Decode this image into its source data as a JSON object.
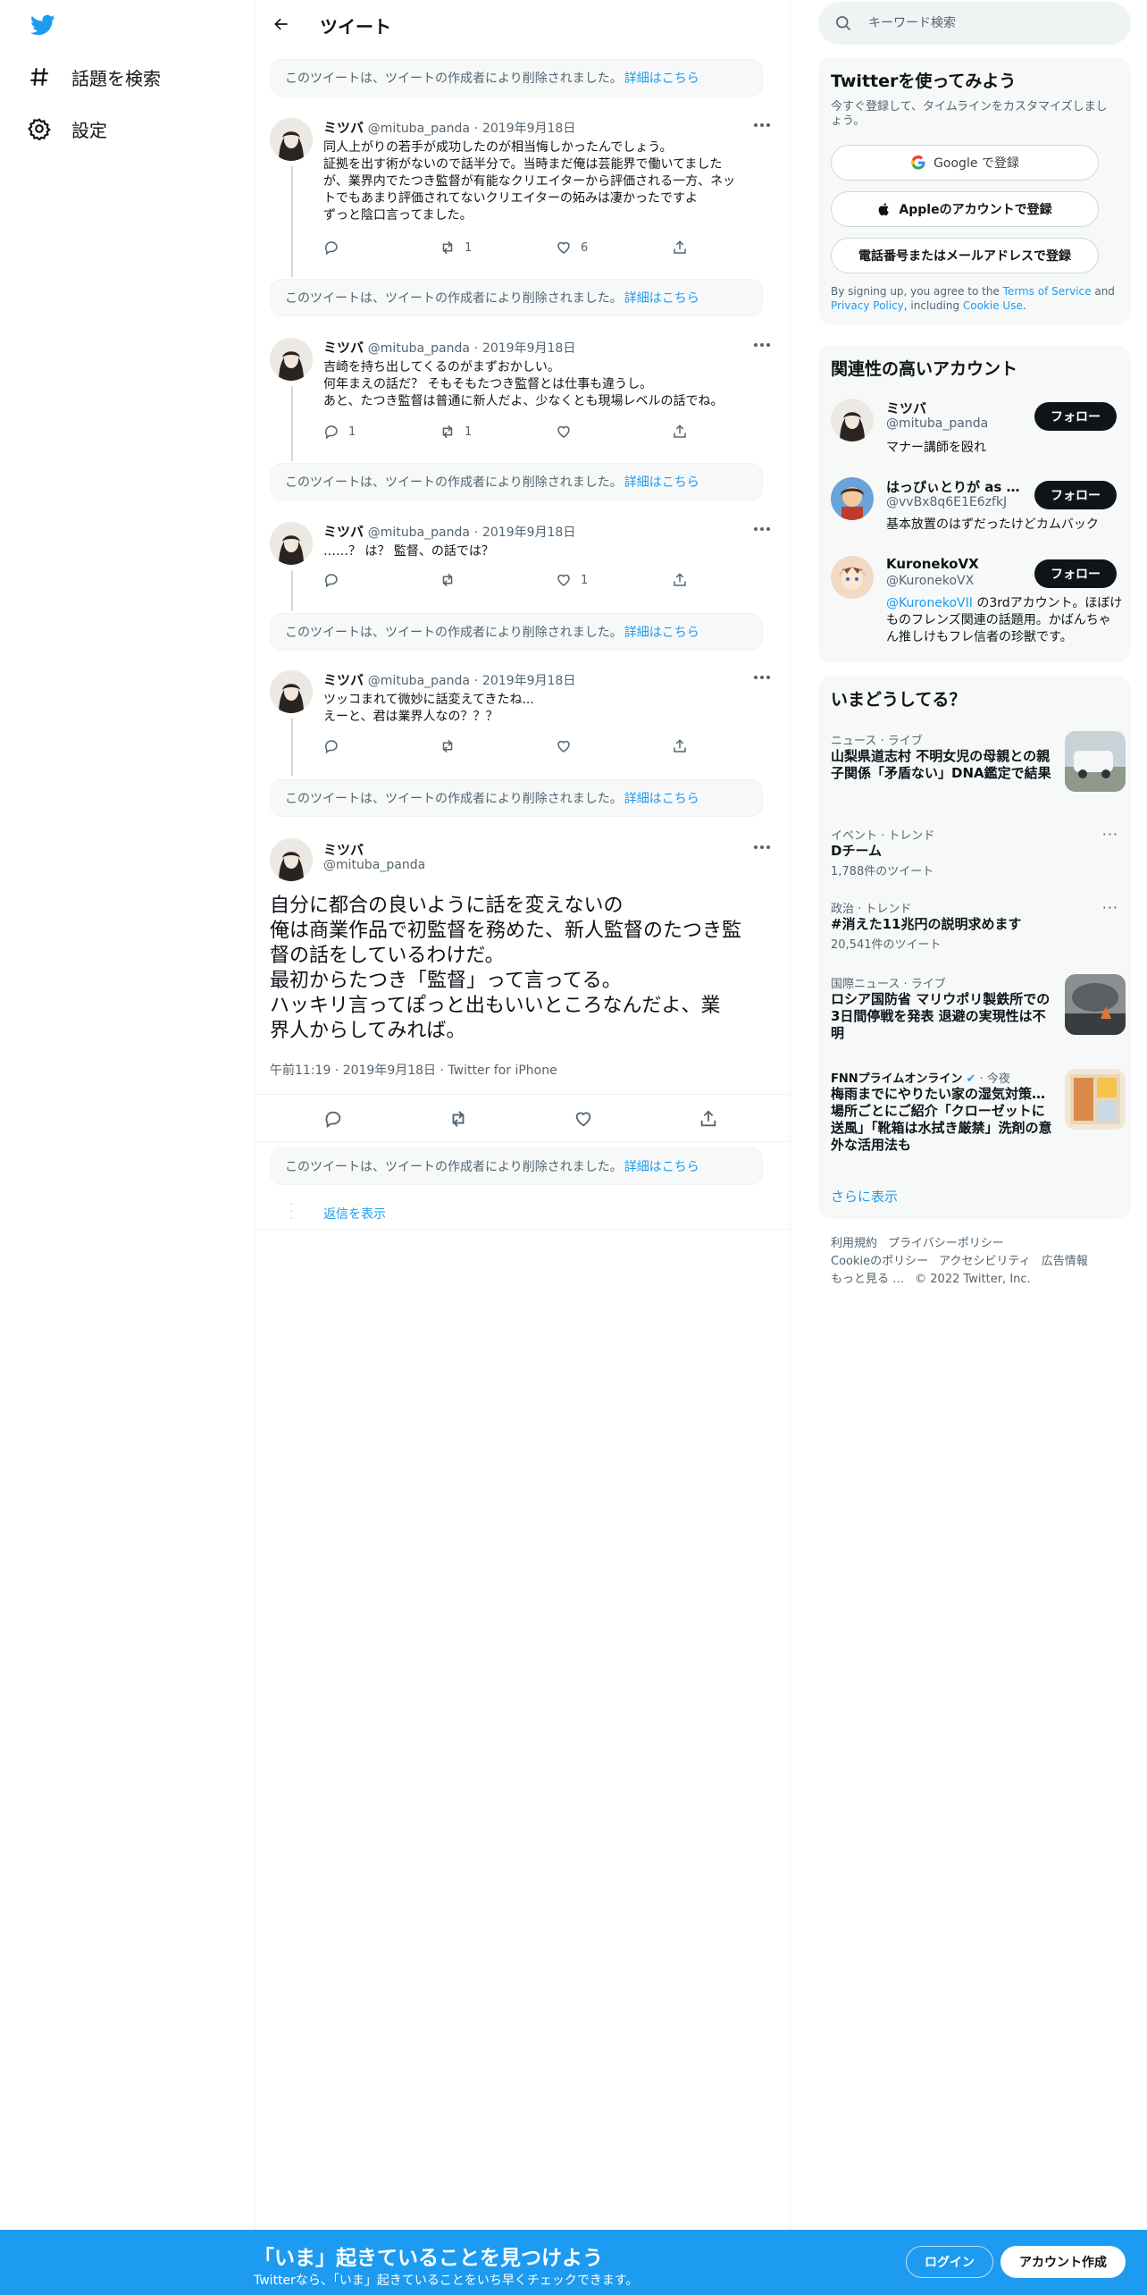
{
  "nav": {
    "logo_icon": "twitter-bird-icon",
    "items": [
      {
        "label": "話題を検索",
        "icon": "hashtag-icon"
      },
      {
        "label": "設定",
        "icon": "gear-icon"
      }
    ]
  },
  "header": {
    "title": "ツイート",
    "back_icon": "arrow-left-icon"
  },
  "deleted_notice": {
    "text": "このツイートは、ツイートの作成者により削除されました。",
    "link": "詳細はこちら"
  },
  "thread": [
    {
      "name": "ミツバ",
      "handle": "@mituba_panda",
      "sep": "·",
      "date": "2019年9月18日",
      "body": "同人上がりの若手が成功したのが相当悔しかったんでしょう。\n証拠を出す術がないので話半分で。当時まだ俺は芸能界で働いてました\nが、業界内でたつき監督が有能なクリエイターから評価される一方、ネッ\nトでもあまり評価されてないクリエイターの妬みは凄かったですよ\nずっと陰口言ってました。",
      "reply": "",
      "retweet": "1",
      "like": "6"
    },
    {
      "name": "ミツバ",
      "handle": "@mituba_panda",
      "sep": "·",
      "date": "2019年9月18日",
      "body": "吉崎を持ち出してくるのがまずおかしい。\n何年まえの話だ？ そもそもたつき監督とは仕事も違うし。\nあと、たつき監督は普通に新人だよ、少なくとも現場レベルの話でね。",
      "reply": "1",
      "retweet": "1",
      "like": ""
    },
    {
      "name": "ミツバ",
      "handle": "@mituba_panda",
      "sep": "·",
      "date": "2019年9月18日",
      "body": "……？ は？ 監督、の話では？",
      "reply": "",
      "retweet": "",
      "like": "1"
    },
    {
      "name": "ミツバ",
      "handle": "@mituba_panda",
      "sep": "·",
      "date": "2019年9月18日",
      "body": "ツッコまれて微妙に話変えてきたね...\nえーと、君は業界人なの？？？",
      "reply": "",
      "retweet": "",
      "like": ""
    }
  ],
  "main_tweet": {
    "name": "ミツバ",
    "handle": "@mituba_panda",
    "body": "自分に都合の良いように話を変えないの\n俺は商業作品で初監督を務めた、新人監督のたつき監\n督の話をしているわけだ。\n最初からたつき「監督」って言ってる。\nハッキリ言ってぽっと出もいいところなんだよ、業\n界人からしてみれば。",
    "meta": "午前11:19 · 2019年9月18日 · Twitter for iPhone"
  },
  "show_replies": "返信を表示",
  "search": {
    "placeholder": "キーワード検索",
    "icon": "search-icon"
  },
  "signup": {
    "title": "Twitterを使ってみよう",
    "subtitle": "今すぐ登録して、タイムラインをカスタマイズしましょう。",
    "google": "Google で登録",
    "apple": "Appleのアカウントで登録",
    "phone": "電話番号またはメールアドレスで登録",
    "terms_prefix": "By signing up, you agree to the ",
    "terms_link": "Terms of Service",
    "terms_and": " and ",
    "privacy_link": "Privacy Policy",
    "terms_including": ", including ",
    "cookie_link": "Cookie Use",
    "terms_end": "."
  },
  "related": {
    "title": "関連性の高いアカウント",
    "follow_label": "フォロー",
    "accounts": [
      {
        "name": "ミツバ",
        "handle": "@mituba_panda",
        "bio": "マナー講師を殴れ"
      },
      {
        "name": "はっぴぃとりが as ...",
        "handle": "@vvBx8q6E1E6zfkJ",
        "bio": "基本放置のはずだったけどカムバック"
      },
      {
        "name": "KuronekoVX",
        "handle": "@KuronekoVX",
        "bio_mention": "@KuronekoVII",
        "bio": " の3rdアカウント。ほぼけものフレンズ関連の話題用。かばんちゃん推しけもフレ信者の珍獣です。"
      }
    ]
  },
  "trends": {
    "title": "いまどうしてる？",
    "items": [
      {
        "category": "ニュース · ライブ",
        "title": "山梨県道志村 不明女児の母親との親子関係「矛盾ない」DNA鑑定で結果",
        "count": ""
      },
      {
        "category": "イベント · トレンド",
        "title": "Dチーム",
        "count": "1,788件のツイート"
      },
      {
        "category": "政治 · トレンド",
        "title": "#消えた11兆円の説明求めます",
        "count": "20,541件のツイート"
      },
      {
        "category": "国際ニュース · ライブ",
        "title": "ロシア国防省 マリウポリ製鉄所での3日間停戦を発表 退避の実現性は不明",
        "count": ""
      },
      {
        "category": "FNNプライムオンライン",
        "category_suffix": " · 今夜",
        "title": "梅雨までにやりたい家の湿気対策…場所ごとにご紹介「クローゼットに送風」「靴箱は水拭き厳禁」洗剤の意外な活用法も",
        "count": ""
      }
    ],
    "more": "さらに表示",
    "dots": "···"
  },
  "footer": {
    "links": [
      "利用規約",
      "プライバシーポリシー",
      "Cookieのポリシー",
      "アクセシビリティ",
      "広告情報",
      "もっと見る …"
    ],
    "copyright": "© 2022 Twitter, Inc."
  },
  "banner": {
    "title": "「いま」起きていることを見つけよう",
    "subtitle": "Twitterなら、「いま」起きていることをいち早くチェックできます。",
    "login": "ログイン",
    "signup": "アカウント作成"
  },
  "colors": {
    "accent": "#1d9bf0",
    "text": "#0f1419",
    "muted": "#536471",
    "banner": "#1d9bf0"
  }
}
